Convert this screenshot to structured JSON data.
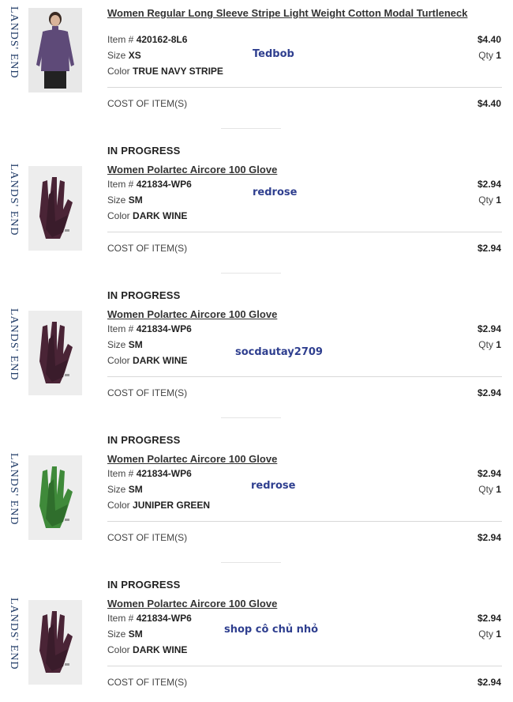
{
  "brand": "LANDS' END",
  "labels": {
    "item": "Item #",
    "size": "Size",
    "color": "Color",
    "qty": "Qty",
    "cost": "COST OF ITEM(S)"
  },
  "items": [
    {
      "status": "",
      "title": "Women Regular Long Sleeve Stripe Light Weight Cotton Modal Turtleneck",
      "item_no": "420162-8L6",
      "size": "XS",
      "color": "TRUE NAVY STRIPE",
      "price": "$4.40",
      "qty": "1",
      "cost": "$4.40",
      "watermark": "Tedbob",
      "image": "purple-turtleneck-image"
    },
    {
      "status": "IN PROGRESS",
      "title": "Women Polartec Aircore 100 Glove",
      "item_no": "421834-WP6",
      "size": "SM",
      "color": "DARK WINE",
      "price": "$2.94",
      "qty": "1",
      "cost": "$2.94",
      "watermark": "redrose",
      "image": "dark-wine-glove-image"
    },
    {
      "status": "IN PROGRESS",
      "title": "Women Polartec Aircore 100 Glove",
      "item_no": "421834-WP6",
      "size": "SM",
      "color": "DARK WINE",
      "price": "$2.94",
      "qty": "1",
      "cost": "$2.94",
      "watermark": "socdautay2709",
      "image": "dark-wine-glove-image"
    },
    {
      "status": "IN PROGRESS",
      "title": "Women Polartec Aircore 100 Glove",
      "item_no": "421834-WP6",
      "size": "SM",
      "color": "JUNIPER GREEN",
      "price": "$2.94",
      "qty": "1",
      "cost": "$2.94",
      "watermark": "redrose",
      "image": "juniper-green-glove-image"
    },
    {
      "status": "IN PROGRESS",
      "title": "Women Polartec Aircore 100 Glove",
      "item_no": "421834-WP6",
      "size": "SM",
      "color": "DARK WINE",
      "price": "$2.94",
      "qty": "1",
      "cost": "$2.94",
      "watermark": "shop cô chủ nhỏ",
      "image": "dark-wine-glove-image"
    }
  ],
  "colors": {
    "wine": "#4a2436",
    "green": "#3f8a3a",
    "purple": "#5e4a78",
    "watermark": "#2f3f8f"
  }
}
